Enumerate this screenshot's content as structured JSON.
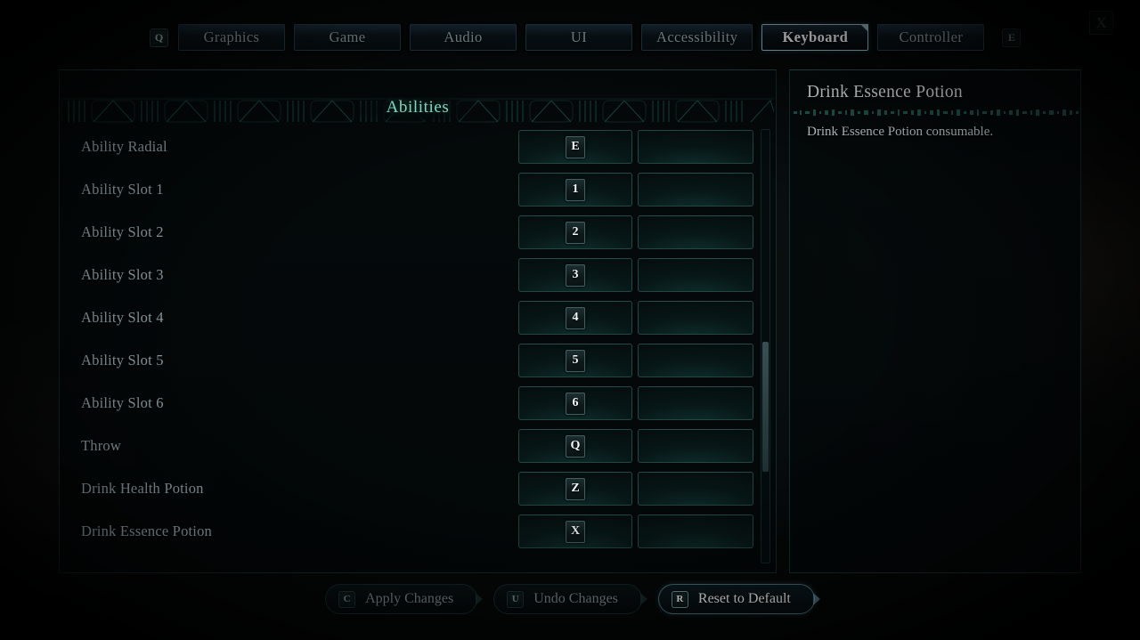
{
  "window": {
    "title": "Keyboard",
    "close_label": "X"
  },
  "tabbar": {
    "prev_key": "Q",
    "next_key": "E",
    "tabs": [
      {
        "label": "Graphics",
        "active": false
      },
      {
        "label": "Game",
        "active": false
      },
      {
        "label": "Audio",
        "active": false
      },
      {
        "label": "UI",
        "active": false
      },
      {
        "label": "Accessibility",
        "active": false
      },
      {
        "label": "Keyboard",
        "active": true
      },
      {
        "label": "Controller",
        "active": false
      }
    ]
  },
  "list_panel": {
    "section_title": "Abilities",
    "scrollbar": {
      "visible": true
    },
    "rows": [
      {
        "label": "Ability Radial",
        "primary": "E",
        "secondary": ""
      },
      {
        "label": "Ability Slot 1",
        "primary": "1",
        "secondary": ""
      },
      {
        "label": "Ability Slot 2",
        "primary": "2",
        "secondary": ""
      },
      {
        "label": "Ability Slot 3",
        "primary": "3",
        "secondary": ""
      },
      {
        "label": "Ability Slot 4",
        "primary": "4",
        "secondary": ""
      },
      {
        "label": "Ability Slot 5",
        "primary": "5",
        "secondary": ""
      },
      {
        "label": "Ability Slot 6",
        "primary": "6",
        "secondary": ""
      },
      {
        "label": "Throw",
        "primary": "Q",
        "secondary": ""
      },
      {
        "label": "Drink Health Potion",
        "primary": "Z",
        "secondary": ""
      },
      {
        "label": "Drink Essence Potion",
        "primary": "X",
        "secondary": ""
      }
    ]
  },
  "info_panel": {
    "title": "Drink Essence Potion",
    "description": "Drink Essence Potion consumable."
  },
  "footer": {
    "buttons": [
      {
        "key": "C",
        "label": "Apply Changes",
        "active": false
      },
      {
        "key": "U",
        "label": "Undo Changes",
        "active": false
      },
      {
        "key": "R",
        "label": "Reset to Default",
        "active": true
      }
    ]
  },
  "colors": {
    "accent_teal": "#7fd9c4",
    "panel_border": "#2e5454",
    "text_primary": "#eef4f5",
    "text_muted": "#7e8d90",
    "label": "#a9bcc4",
    "highlight_border": "#9fc7d6"
  }
}
